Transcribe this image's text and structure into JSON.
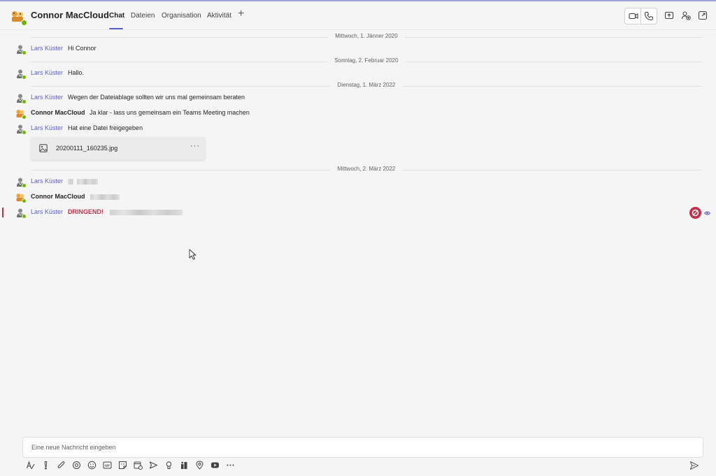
{
  "header": {
    "contact_name": "Connor MacCloud",
    "tabs": [
      {
        "label": "Chat",
        "active": true
      },
      {
        "label": "Dateien",
        "active": false
      },
      {
        "label": "Organisation",
        "active": false
      },
      {
        "label": "Aktivität",
        "active": false
      }
    ],
    "add_tab_symbol": "+",
    "actions": [
      "video-call-icon",
      "audio-call-icon",
      "share-screen-icon",
      "add-people-icon",
      "pop-out-icon"
    ]
  },
  "conversation": {
    "date_separators": [
      "Mittwoch, 1. Jänner 2020",
      "Sonntag, 2. Februar 2020",
      "Dienstag, 1. März 2022",
      "Mittwoch, 2. März 2022"
    ],
    "messages": [
      {
        "sender": "Lars Küster",
        "text": "Hi Connor"
      },
      {
        "sender": "Lars Küster",
        "text": "Hallo."
      },
      {
        "sender": "Lars Küster",
        "text": "Wegen der Dateiablage sollten wir uns mal gemeinsam beraten"
      },
      {
        "sender": "Connor MacCloud",
        "text": "Ja klar - lass uns gemeinsam ein Teams Meeting machen"
      },
      {
        "sender": "Lars Küster",
        "text": "Hat eine Datei freigegeben"
      },
      {
        "sender": "Lars Küster",
        "text": ""
      },
      {
        "sender": "Connor MacCloud",
        "text": ""
      },
      {
        "sender": "Lars Küster",
        "urgent_label": "DRINGEND!",
        "text": ""
      }
    ],
    "attachment": {
      "file_name": "20200111_160235.jpg",
      "more_symbol": "···"
    }
  },
  "compose": {
    "placeholder": "Eine neue Nachricht eingeben",
    "more_symbol": "···",
    "toolbar": [
      "format-icon",
      "important-icon",
      "attach-icon",
      "loop-icon",
      "emoji-icon",
      "gif-icon",
      "sticker-icon",
      "schedule-meeting-icon",
      "send-later-icon",
      "praise-icon",
      "apps-icon",
      "location-icon",
      "youtube-icon",
      "more-options-icon"
    ]
  },
  "colors": {
    "accent": "#5b5fc7",
    "urgent": "#c4314b",
    "presence_available": "#6bb700",
    "background": "#f5f5f5"
  }
}
